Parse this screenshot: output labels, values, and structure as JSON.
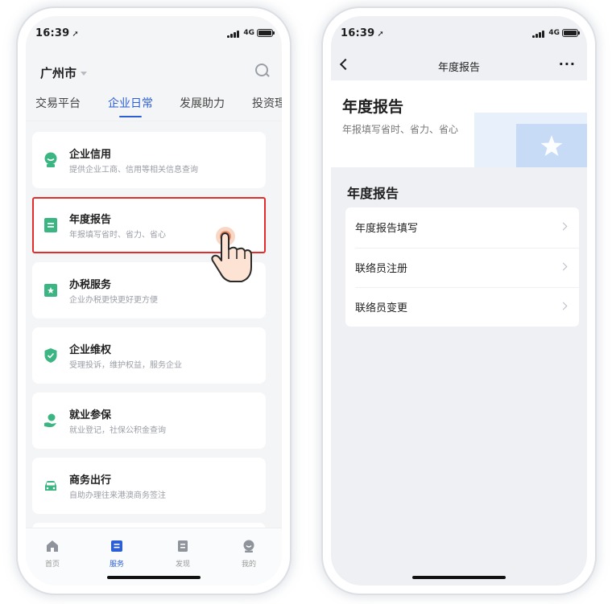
{
  "status_bar": {
    "time": "16:39",
    "network": "4G"
  },
  "left_screen": {
    "city": "广州市",
    "tabs": [
      {
        "label": "交易平台",
        "active": false
      },
      {
        "label": "企业日常",
        "active": true
      },
      {
        "label": "发展助力",
        "active": false
      },
      {
        "label": "投资理",
        "active": false
      }
    ],
    "cards": [
      {
        "title": "企业信用",
        "subtitle": "提供企业工商、信用等相关信息查询",
        "icon": "credit-icon",
        "highlighted": false
      },
      {
        "title": "年度报告",
        "subtitle": "年报填写省时、省力、省心",
        "icon": "report-icon",
        "highlighted": true
      },
      {
        "title": "办税服务",
        "subtitle": "企业办税更快更好更方便",
        "icon": "tax-icon",
        "highlighted": false
      },
      {
        "title": "企业维权",
        "subtitle": "受理投诉，维护权益，服务企业",
        "icon": "shield-icon",
        "highlighted": false
      },
      {
        "title": "就业参保",
        "subtitle": "就业登记，社保公积金查询",
        "icon": "insurance-icon",
        "highlighted": false
      },
      {
        "title": "商务出行",
        "subtitle": "自助办理往来港澳商务签注",
        "icon": "car-icon",
        "highlighted": false
      }
    ],
    "tabbar": [
      {
        "label": "首页",
        "active": false,
        "icon": "home-icon"
      },
      {
        "label": "服务",
        "active": true,
        "icon": "service-icon"
      },
      {
        "label": "发现",
        "active": false,
        "icon": "discover-icon"
      },
      {
        "label": "我的",
        "active": false,
        "icon": "profile-icon"
      }
    ]
  },
  "right_screen": {
    "nav_title": "年度报告",
    "more_label": "···",
    "hero": {
      "title": "年度报告",
      "subtitle": "年报填写省时、省力、省心"
    },
    "section_title": "年度报告",
    "items": [
      {
        "label": "年度报告填写"
      },
      {
        "label": "联络员注册"
      },
      {
        "label": "联络员变更"
      }
    ]
  },
  "colors": {
    "accent": "#2c5fd6",
    "highlight": "#e32c2c",
    "icon_green": "#3bb582"
  }
}
